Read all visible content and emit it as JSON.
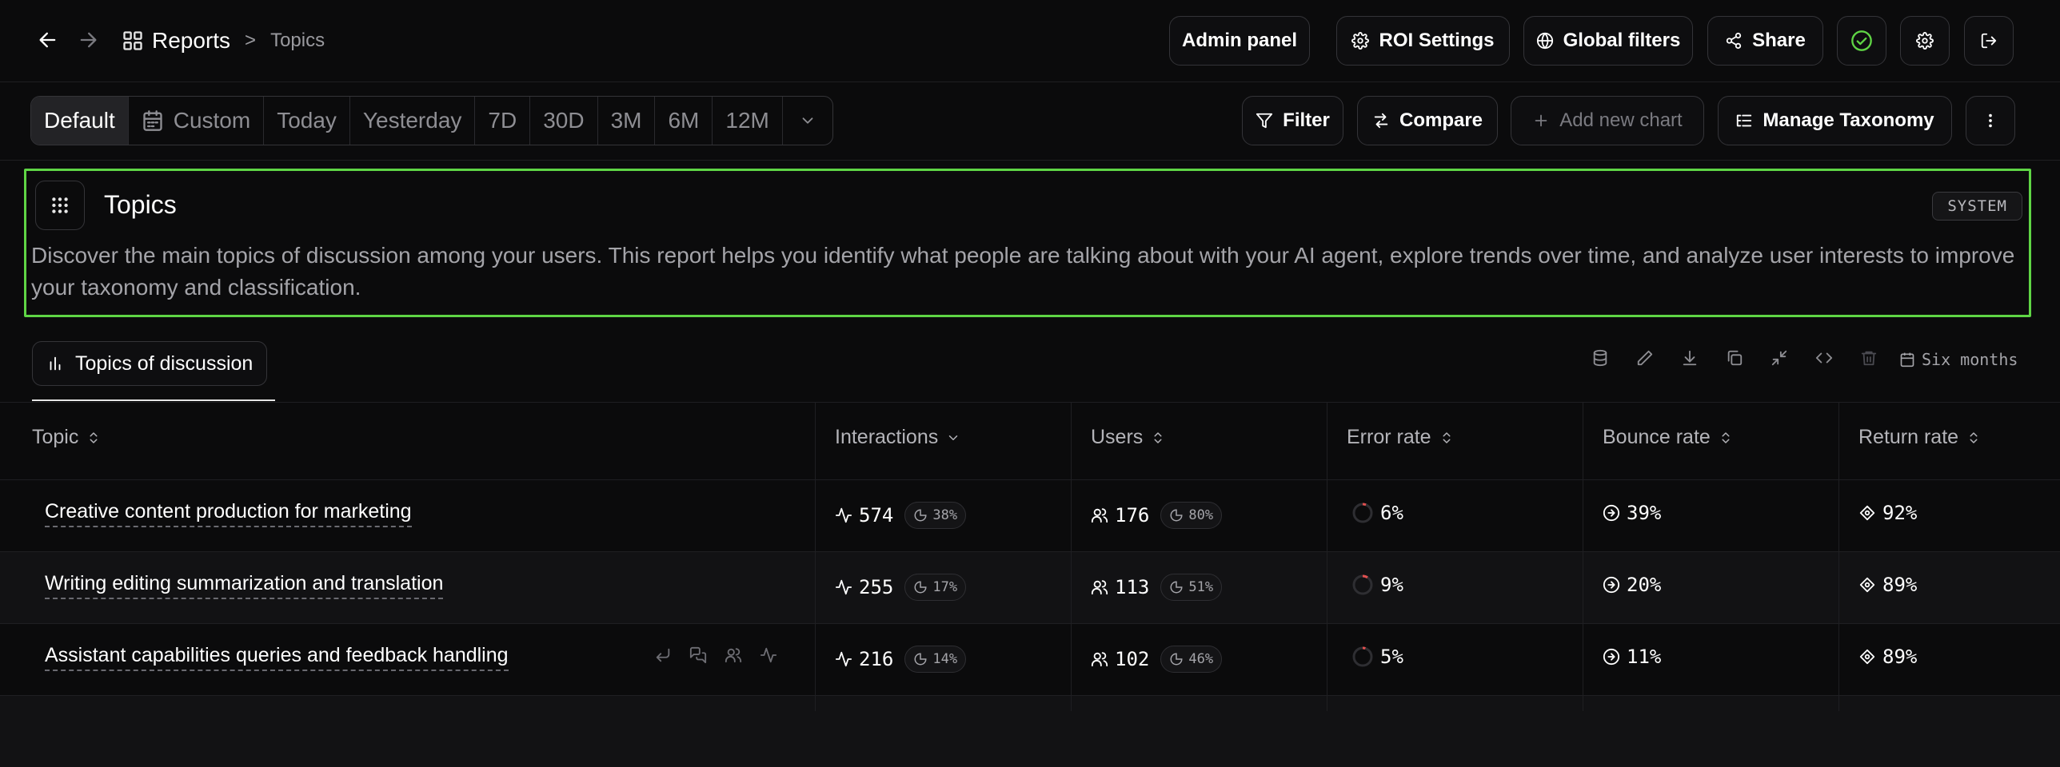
{
  "header": {
    "breadcrumb_main": "Reports",
    "breadcrumb_sep": ">",
    "breadcrumb_sub": "Topics",
    "buttons": {
      "admin": "Admin panel",
      "roi": "ROI Settings",
      "filters": "Global filters",
      "share": "Share"
    }
  },
  "toolbar": {
    "ranges": [
      "Default",
      "Custom",
      "Today",
      "Yesterday",
      "7D",
      "30D",
      "3M",
      "6M",
      "12M"
    ],
    "active_range": "Default",
    "filter": "Filter",
    "compare": "Compare",
    "add_chart": "Add new chart",
    "taxonomy": "Manage Taxonomy"
  },
  "report": {
    "title": "Topics",
    "badge": "SYSTEM",
    "description": "Discover the main topics of discussion among your users. This report helps you identify what people are talking about with your AI agent, explore trends over time, and analyze user interests to improve your taxonomy and classification."
  },
  "chart": {
    "tab_label": "Topics of discussion",
    "period": "Six months"
  },
  "table": {
    "columns": [
      "Topic",
      "Interactions",
      "Users",
      "Error rate",
      "Bounce rate",
      "Return rate"
    ],
    "rows": [
      {
        "topic": "Creative content production for marketing",
        "interactions": "574",
        "interactions_pct": "38%",
        "users": "176",
        "users_pct": "80%",
        "error": "6%",
        "bounce": "39%",
        "return": "92%"
      },
      {
        "topic": "Writing editing summarization and translation",
        "interactions": "255",
        "interactions_pct": "17%",
        "users": "113",
        "users_pct": "51%",
        "error": "9%",
        "bounce": "20%",
        "return": "89%"
      },
      {
        "topic": "Assistant capabilities queries and feedback handling",
        "interactions": "216",
        "interactions_pct": "14%",
        "users": "102",
        "users_pct": "46%",
        "error": "5%",
        "bounce": "11%",
        "return": "89%"
      }
    ]
  },
  "colors": {
    "accent_green": "#5fd545",
    "background": "#0b0b0c"
  }
}
